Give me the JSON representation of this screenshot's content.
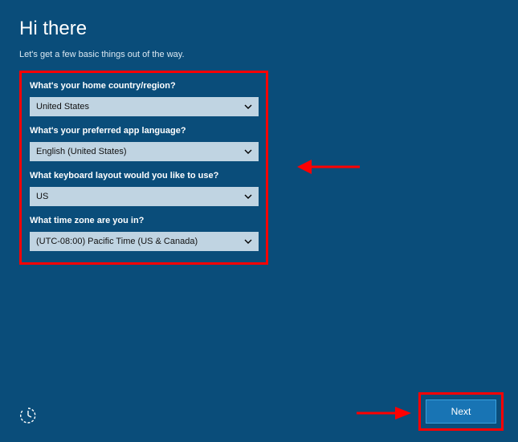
{
  "header": {
    "title": "Hi there",
    "subtitle": "Let's get a few basic things out of the way."
  },
  "form": {
    "country": {
      "label": "What's your home country/region?",
      "value": "United States"
    },
    "language": {
      "label": "What's your preferred app language?",
      "value": "English (United States)"
    },
    "keyboard": {
      "label": "What keyboard layout would you like to use?",
      "value": "US"
    },
    "timezone": {
      "label": "What time zone are you in?",
      "value": "(UTC-08:00) Pacific Time (US & Canada)"
    }
  },
  "footer": {
    "next_label": "Next"
  },
  "annotations": {
    "highlight_color": "#ff0000"
  }
}
